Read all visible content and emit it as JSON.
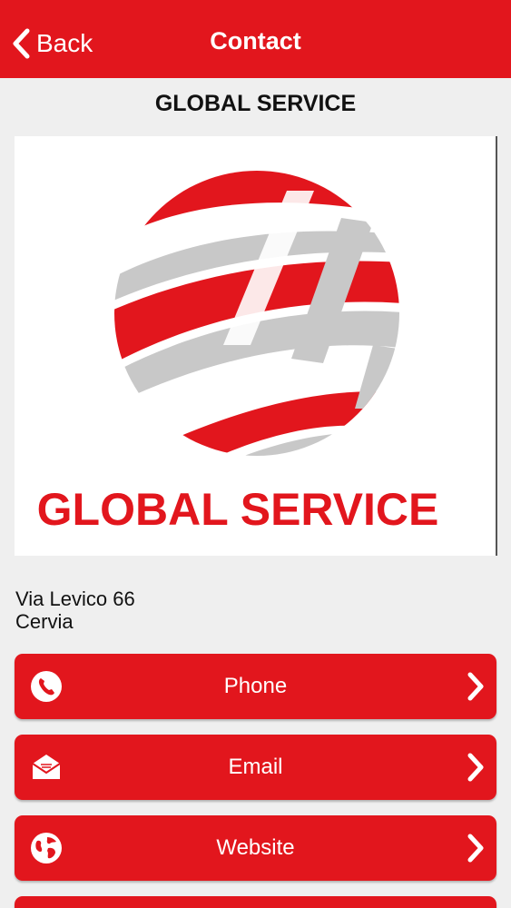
{
  "navbar": {
    "back_label": "Back",
    "title": "Contact",
    "color": "#e2161d"
  },
  "company": {
    "name": "GLOBAL SERVICE",
    "logo_text": "GLOBAL SERVICE"
  },
  "address": {
    "street": "Via Levico 66",
    "city": "Cervia"
  },
  "actions": [
    {
      "label": "Phone",
      "icon": "phone-icon"
    },
    {
      "label": "Email",
      "icon": "email-icon"
    },
    {
      "label": "Website",
      "icon": "globe-icon"
    }
  ]
}
